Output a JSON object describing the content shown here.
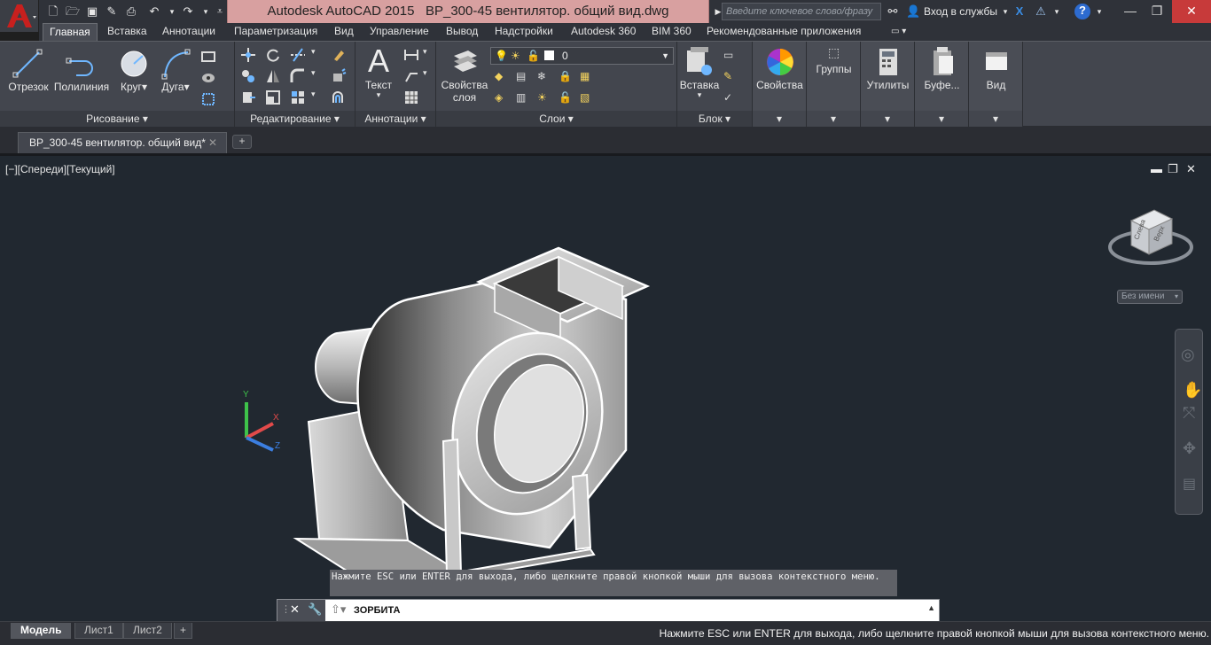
{
  "app": {
    "title": "Autodesk AutoCAD 2015",
    "document": "ВР_300-45 вентилятор. общий вид.dwg",
    "search_placeholder": "Введите ключевое слово/фразу",
    "signin": "Вход в службы"
  },
  "ribbon_tabs": [
    "Главная",
    "Вставка",
    "Аннотации",
    "Параметризация",
    "Вид",
    "Управление",
    "Вывод",
    "Надстройки",
    "Autodesk 360",
    "BIM 360",
    "Рекомендованные приложения"
  ],
  "ribbon": {
    "draw": {
      "title": "Рисование ▾",
      "line": "Отрезок",
      "polyline": "Полилиния",
      "circle": "Круг",
      "arc": "Дуга"
    },
    "modify": {
      "title": "Редактирование ▾"
    },
    "annotation": {
      "title": "Аннотации ▾",
      "text": "Текст"
    },
    "layers": {
      "title": "Слои ▾",
      "props_line1": "Свойства",
      "props_line2": "слоя",
      "current_layer": "0"
    },
    "block": {
      "title": "Блок ▾",
      "insert": "Вставка"
    },
    "properties": {
      "label": "Свойства"
    },
    "groups": {
      "label": "Группы"
    },
    "utilities": {
      "label": "Утилиты"
    },
    "clipboard": {
      "label": "Буфе..."
    },
    "view": {
      "label": "Вид"
    }
  },
  "doc_tab": {
    "label": "ВР_300-45 вентилятор. общий вид*",
    "close": "✕",
    "new": "+"
  },
  "viewport": {
    "label": "[−][Спереди][Текущий]",
    "viewcube_top": "Верх",
    "viewcube_left": "Слева",
    "unnamed_ucs": "Без имени",
    "ucs_x": "X",
    "ucs_y": "Y",
    "ucs_z": "Z"
  },
  "command": {
    "tooltip": "Нажмите ESC или ENTER для выхода, либо щелкните правой кнопкой мыши для вызова контекстного меню.",
    "current": "ЗОРБИТА"
  },
  "layout_tabs": [
    "Модель",
    "Лист1",
    "Лист2"
  ],
  "status_message": "Нажмите ESC или ENTER для выхода, либо щелкните правой кнопкой мыши для вызова контекстного меню."
}
